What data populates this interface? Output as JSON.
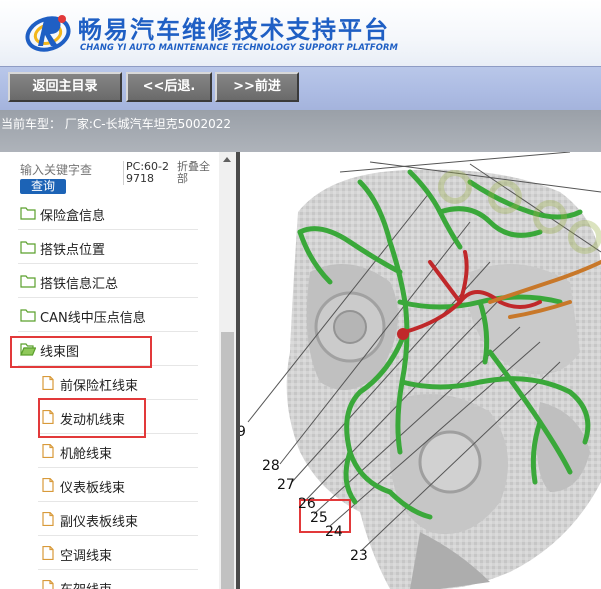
{
  "header": {
    "title": "畅易汽车维修技术支持平台",
    "subtitle": "CHANG YI AUTO MAINTENANCE TECHNOLOGY SUPPORT PLATFORM"
  },
  "toolbar": {
    "home_label": "返回主目录",
    "back_label": "<<后退.",
    "forward_label": ">>前进"
  },
  "vehicle": {
    "info": "当前车型：  厂家:C-长城汽车坦克5002022"
  },
  "sidebar": {
    "search_placeholder": "输入关键字查",
    "search_button": "查询",
    "pc_code": "PC:60-29718",
    "collapse_all": "折叠全部",
    "items": [
      {
        "label": "保险盒信息"
      },
      {
        "label": "搭铁点位置"
      },
      {
        "label": "搭铁信息汇总"
      },
      {
        "label": "CAN线中压点信息"
      },
      {
        "label": "线束图"
      }
    ],
    "children": [
      {
        "label": "前保险杠线束"
      },
      {
        "label": "发动机线束"
      },
      {
        "label": "机舱线束"
      },
      {
        "label": "仪表板线束"
      },
      {
        "label": "副仪表板线束"
      },
      {
        "label": "空调线束"
      },
      {
        "label": "车架线束"
      }
    ]
  },
  "diagram": {
    "callouts": [
      "9",
      "28",
      "27",
      "26",
      "25",
      "24",
      "23"
    ]
  },
  "colors": {
    "brand": "#1f5fc4",
    "toolbar": "#aebde4",
    "button": "#777777",
    "highlight": "#e2393a",
    "harness_green": "#3aa83a",
    "harness_red": "#c0282a",
    "harness_orange": "#c8782a",
    "search_button": "#1c63b6"
  }
}
